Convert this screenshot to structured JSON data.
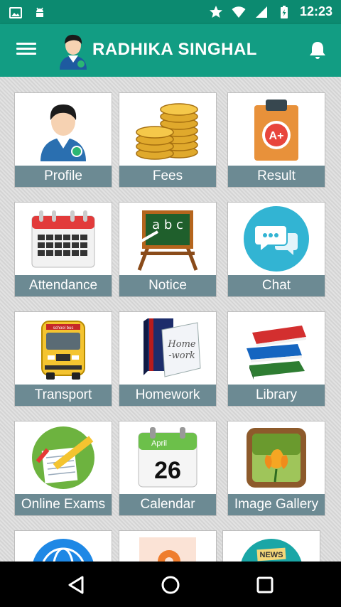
{
  "status_bar": {
    "time": "12:23",
    "left_icons": [
      "image-icon",
      "android-icon"
    ],
    "right_icons": [
      "star-icon",
      "wifi-icon",
      "signal-icon",
      "battery-icon"
    ]
  },
  "app_bar": {
    "title": "RADHIKA SINGHAL",
    "menu_icon": "menu-icon",
    "avatar_icon": "user-avatar-icon",
    "notification_icon": "bell-icon"
  },
  "colors": {
    "status_bar": "#0c8a70",
    "app_bar": "#129d83",
    "tile_label": "#6c8a93",
    "navbar": "#000000"
  },
  "tiles": [
    {
      "label": "Profile",
      "icon": "profile-icon"
    },
    {
      "label": "Fees",
      "icon": "coins-icon"
    },
    {
      "label": "Result",
      "icon": "result-clipboard-icon"
    },
    {
      "label": "Attendance",
      "icon": "attendance-calendar-icon"
    },
    {
      "label": "Notice",
      "icon": "notice-board-icon"
    },
    {
      "label": "Chat",
      "icon": "chat-bubble-icon"
    },
    {
      "label": "Transport",
      "icon": "school-bus-icon"
    },
    {
      "label": "Homework",
      "icon": "homework-book-icon"
    },
    {
      "label": "Library",
      "icon": "books-stack-icon"
    },
    {
      "label": "Online Exams",
      "icon": "exam-paper-icon"
    },
    {
      "label": "Calendar",
      "icon": "calendar-date-icon"
    },
    {
      "label": "Image Gallery",
      "icon": "photo-flower-icon"
    },
    {
      "label": "",
      "icon": "globe-icon"
    },
    {
      "label": "",
      "icon": "location-pin-icon"
    },
    {
      "label": "",
      "icon": "news-icon"
    }
  ],
  "content_text": {
    "result_grade": "A+",
    "notice_letters": "a b c",
    "homework_text_line1": "Home",
    "homework_text_line2": "-work",
    "calendar_month": "April",
    "calendar_day": "26",
    "bus_text": "school bus",
    "news_text": "NEWS"
  },
  "nav_bar": {
    "buttons": [
      "back-icon",
      "home-icon",
      "recents-icon"
    ]
  }
}
